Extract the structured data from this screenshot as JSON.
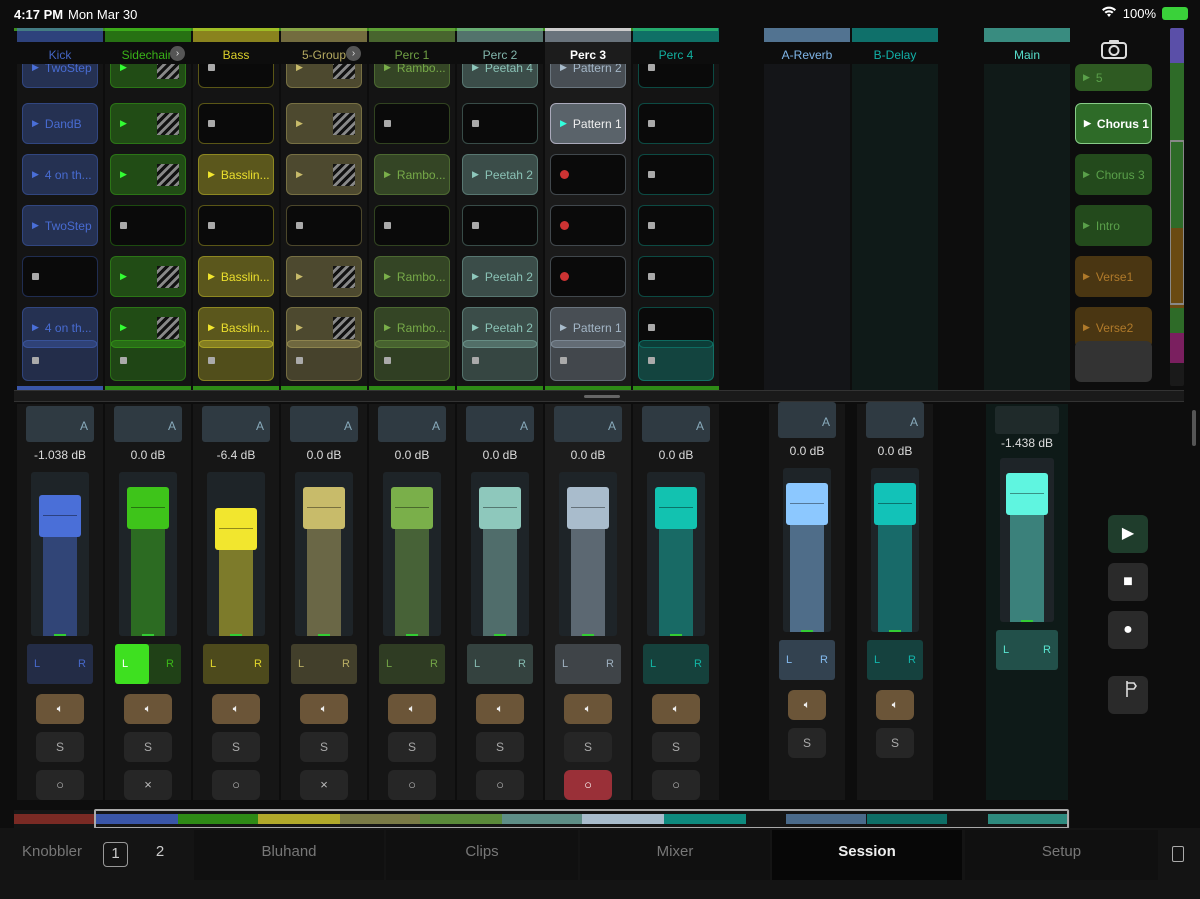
{
  "status": {
    "time": "4:17 PM",
    "date": "Mon Mar 30",
    "battery": "100%"
  },
  "tracks": [
    {
      "name": "Kick",
      "color": "#4a6fd8",
      "db": "-1.038 dB",
      "level": 0.73,
      "arm": "○",
      "clips": [
        {
          "kind": "play",
          "label": "TwoStep"
        },
        {
          "kind": "play",
          "label": "DandB"
        },
        {
          "kind": "play",
          "label": "4 on th..."
        },
        {
          "kind": "play",
          "label": "TwoStep"
        },
        {
          "kind": "stop",
          "label": ""
        },
        {
          "kind": "play",
          "label": "4 on th..."
        },
        {
          "kind": "stop",
          "label": ""
        }
      ]
    },
    {
      "name": "Sidechain",
      "color": "#3ec41a",
      "db": "0.0 dB",
      "level": 0.78,
      "arm": "×",
      "clips": [
        {
          "kind": "hatch",
          "label": ""
        },
        {
          "kind": "hatch",
          "label": ""
        },
        {
          "kind": "hatch",
          "label": ""
        },
        {
          "kind": "stop",
          "label": ""
        },
        {
          "kind": "hatch",
          "label": ""
        },
        {
          "kind": "hatch",
          "label": ""
        },
        {
          "kind": "stop",
          "label": ""
        }
      ]
    },
    {
      "name": "Bass",
      "color": "#f2e62e",
      "db": "-6.4 dB",
      "level": 0.65,
      "arm": "○",
      "clips": [
        {
          "kind": "stop",
          "label": ""
        },
        {
          "kind": "stop",
          "label": ""
        },
        {
          "kind": "play",
          "label": "Basslin..."
        },
        {
          "kind": "stop",
          "label": ""
        },
        {
          "kind": "play",
          "label": "Basslin..."
        },
        {
          "kind": "play",
          "label": "Basslin..."
        },
        {
          "kind": "stop",
          "label": ""
        }
      ]
    },
    {
      "name": "5-Group",
      "color": "#c8bb6a",
      "db": "0.0 dB",
      "level": 0.78,
      "arm": "×",
      "clips": [
        {
          "kind": "hatch",
          "label": ""
        },
        {
          "kind": "hatch",
          "label": ""
        },
        {
          "kind": "hatch",
          "label": ""
        },
        {
          "kind": "stop",
          "label": ""
        },
        {
          "kind": "hatch",
          "label": ""
        },
        {
          "kind": "hatch",
          "label": ""
        },
        {
          "kind": "stop",
          "label": ""
        }
      ]
    },
    {
      "name": "Perc 1",
      "color": "#7aaf4a",
      "db": "0.0 dB",
      "level": 0.78,
      "arm": "○",
      "clips": [
        {
          "kind": "play",
          "label": "Rambo..."
        },
        {
          "kind": "stop",
          "label": ""
        },
        {
          "kind": "play",
          "label": "Rambo..."
        },
        {
          "kind": "stop",
          "label": ""
        },
        {
          "kind": "play",
          "label": "Rambo..."
        },
        {
          "kind": "play",
          "label": "Rambo..."
        },
        {
          "kind": "stop",
          "label": ""
        }
      ]
    },
    {
      "name": "Perc 2",
      "color": "#8ec8bc",
      "db": "0.0 dB",
      "level": 0.78,
      "arm": "○",
      "clips": [
        {
          "kind": "play",
          "label": "Peetah 4"
        },
        {
          "kind": "stop",
          "label": ""
        },
        {
          "kind": "play",
          "label": "Peetah 2"
        },
        {
          "kind": "stop",
          "label": ""
        },
        {
          "kind": "play",
          "label": "Peetah 2"
        },
        {
          "kind": "play",
          "label": "Peetah 2"
        },
        {
          "kind": "stop",
          "label": ""
        }
      ]
    },
    {
      "name": "Perc 3",
      "color": "#a9bccc",
      "db": "0.0 dB",
      "level": 0.78,
      "arm": "○",
      "clips": [
        {
          "kind": "play",
          "label": "Pattern 2"
        },
        {
          "kind": "playing",
          "label": "Pattern 1"
        },
        {
          "kind": "rec",
          "label": ""
        },
        {
          "kind": "rec",
          "label": ""
        },
        {
          "kind": "rec",
          "label": ""
        },
        {
          "kind": "play",
          "label": "Pattern 1"
        },
        {
          "kind": "stop",
          "label": ""
        }
      ]
    },
    {
      "name": "Perc 4",
      "color": "#12c2b0",
      "db": "0.0 dB",
      "level": 0.78,
      "arm": "○",
      "clips": [
        {
          "kind": "stop",
          "label": ""
        },
        {
          "kind": "stop",
          "label": ""
        },
        {
          "kind": "stop",
          "label": ""
        },
        {
          "kind": "stop",
          "label": ""
        },
        {
          "kind": "stop",
          "label": ""
        },
        {
          "kind": "stop",
          "label": ""
        },
        {
          "kind": "stop",
          "label": ""
        }
      ]
    }
  ],
  "returns": [
    {
      "name": "A-Reverb",
      "color": "#8cc8ff",
      "db": "0.0 dB",
      "level": 0.78
    },
    {
      "name": "B-Delay",
      "color": "#12c2b8",
      "db": "0.0 dB",
      "level": 0.78
    }
  ],
  "master": {
    "name": "Main",
    "color": "#5ff5e0",
    "db": "-1.438 dB",
    "level": 0.78
  },
  "scenes": [
    {
      "label": "5",
      "active": false,
      "color": "#2e5a22"
    },
    {
      "label": "Chorus 1",
      "active": true,
      "color": "#2e6b28"
    },
    {
      "label": "Chorus 3",
      "active": false,
      "color": "#234a1c"
    },
    {
      "label": "Intro",
      "active": false,
      "color": "#234a1c"
    },
    {
      "label": "Verse1",
      "active": false,
      "color": "#4a3612"
    },
    {
      "label": "Verse2",
      "active": false,
      "color": "#4a3612"
    }
  ],
  "labels": {
    "pan_l": "L",
    "pan_r": "R",
    "io": "A",
    "solo": "S",
    "arrow": "›"
  },
  "nav": {
    "knobbler": "Knobbler",
    "page1": "1",
    "page2": "2",
    "bluhand": "Bluhand",
    "clips": "Clips",
    "mixer": "Mixer",
    "session": "Session",
    "setup": "Setup"
  }
}
